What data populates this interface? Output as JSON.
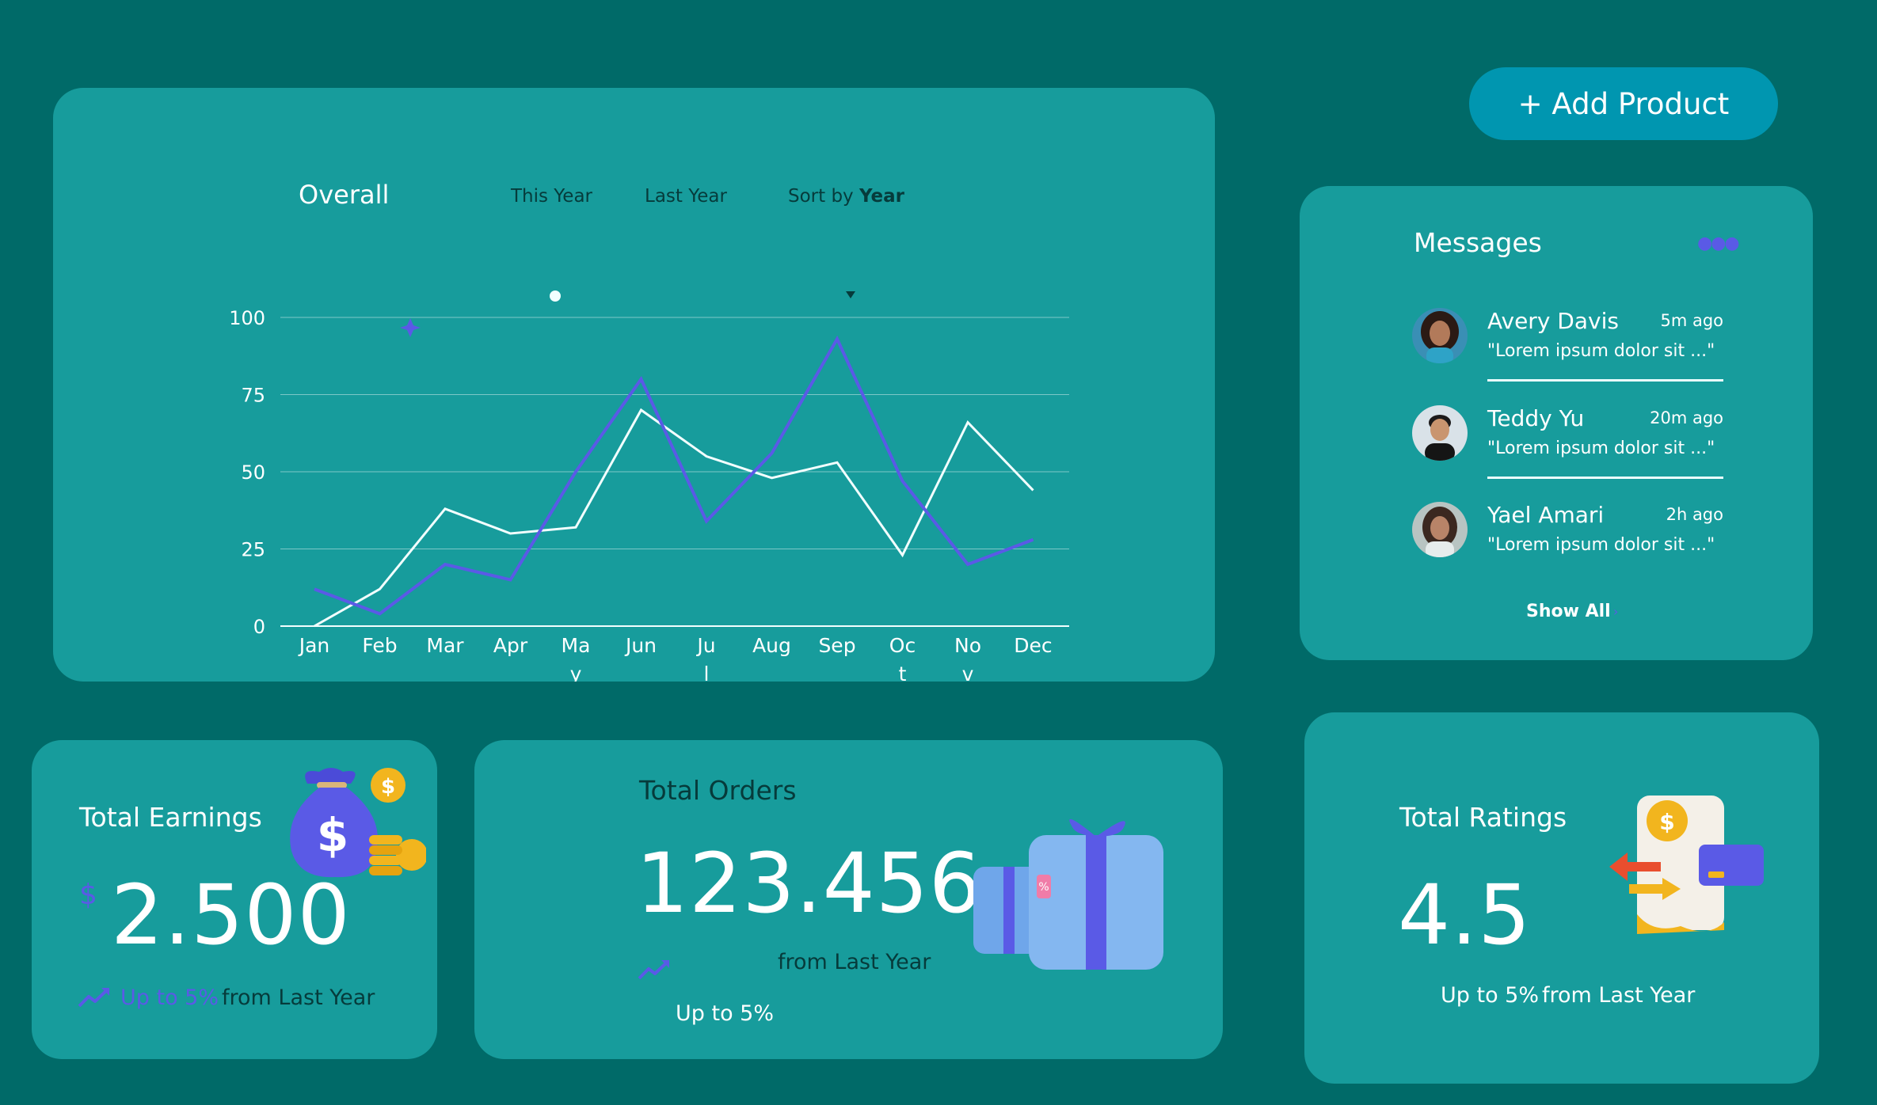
{
  "actions": {
    "add_product_label": "+ Add Product"
  },
  "overall": {
    "title": "Overall",
    "tabs": [
      "This Year",
      "Last Year"
    ],
    "sort_prefix": "Sort by",
    "sort_value": "Year"
  },
  "chart_data": {
    "type": "line",
    "categories": [
      "Jan",
      "Feb",
      "Mar",
      "Apr",
      "May",
      "Jun",
      "Jul",
      "Aug",
      "Sep",
      "Oct",
      "Nov",
      "Dec"
    ],
    "category_display": [
      [
        "Jan"
      ],
      [
        "Feb"
      ],
      [
        "Mar"
      ],
      [
        "Apr"
      ],
      [
        "Ma",
        "y"
      ],
      [
        "Jun"
      ],
      [
        "Ju",
        "l"
      ],
      [
        "Aug"
      ],
      [
        "Sep"
      ],
      [
        "Oc",
        "t"
      ],
      [
        "No",
        "v"
      ],
      [
        "Dec"
      ]
    ],
    "series": [
      {
        "values": [
          0,
          12,
          38,
          30,
          32,
          70,
          55,
          48,
          53,
          23,
          66,
          44
        ],
        "color": "#f2ffff"
      },
      {
        "values": [
          12,
          4,
          20,
          15,
          50,
          80,
          34,
          56,
          93,
          47,
          20,
          28
        ],
        "color": "#5a5ae6"
      }
    ],
    "yticks": [
      0,
      25,
      50,
      75,
      100
    ],
    "ylim": [
      0,
      100
    ],
    "grid": true,
    "xlabel": "",
    "ylabel": ""
  },
  "messages": {
    "title": "Messages",
    "more_icon": "more-dots-icon",
    "items": [
      {
        "name": "Avery Davis",
        "time": "5m ago",
        "text": "\"Lorem ipsum dolor sit ...\""
      },
      {
        "name": "Teddy Yu",
        "time": "20m ago",
        "text": "\"Lorem ipsum dolor sit ...\""
      },
      {
        "name": "Yael Amari",
        "time": "2h ago",
        "text": "\"Lorem ipsum dolor sit ...\""
      }
    ],
    "show_all": "Show All"
  },
  "earnings": {
    "title": "Total Earnings",
    "currency": "$",
    "value": "2.500",
    "trend_up": "Up to 5%",
    "trend_rest": "from Last Year"
  },
  "orders": {
    "title": "Total Orders",
    "value": "123.456",
    "trend_rest": "from Last Year",
    "trend_up": "Up to 5%"
  },
  "ratings": {
    "title": "Total Ratings",
    "value": "4.5",
    "trend_up": "Up to 5%",
    "trend_rest": "from Last Year"
  },
  "colors": {
    "background": "#006a68",
    "card": "#179c9c",
    "accent": "#5a5ae6",
    "button": "#0096b0",
    "dark_text": "#063b3b"
  }
}
